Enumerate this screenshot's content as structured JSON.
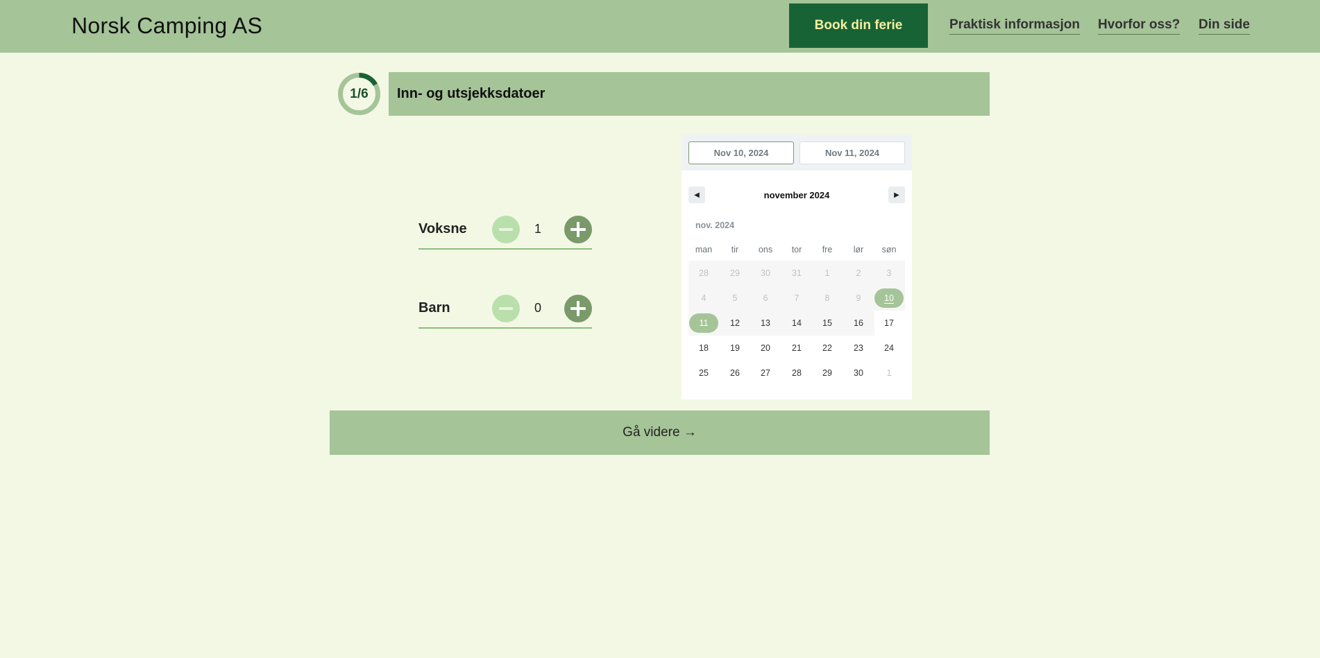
{
  "header": {
    "brand": "Norsk Camping AS",
    "book_button": "Book din ferie",
    "nav": [
      "Praktisk informasjon",
      "Hvorfor oss?",
      "Din side"
    ]
  },
  "step": {
    "indicator": "1/6",
    "progress": 0.1667,
    "title": "Inn- og utsjekksdatoer"
  },
  "guests": [
    {
      "label": "Voksne",
      "value": "1"
    },
    {
      "label": "Barn",
      "value": "0"
    }
  ],
  "datepicker": {
    "checkin": "Nov 10, 2024",
    "checkout": "Nov 11, 2024",
    "month_label": "november 2024",
    "sub_label": "nov. 2024",
    "weekdays": [
      "man",
      "tir",
      "ons",
      "tor",
      "fre",
      "lør",
      "søn"
    ],
    "weeks": [
      [
        "28",
        "29",
        "30",
        "31",
        "1",
        "2",
        "3"
      ],
      [
        "4",
        "5",
        "6",
        "7",
        "8",
        "9",
        "10"
      ],
      [
        "11",
        "12",
        "13",
        "14",
        "15",
        "16",
        "17"
      ],
      [
        "18",
        "19",
        "20",
        "21",
        "22",
        "23",
        "24"
      ],
      [
        "25",
        "26",
        "27",
        "28",
        "29",
        "30",
        "1"
      ]
    ]
  },
  "continue_button": "Gå videre →",
  "colors": {
    "page_bg": "#f3f8e4",
    "header_bg": "#a5c498",
    "book_bg": "#186335",
    "book_text": "#f5efa3",
    "plus_bg": "#7a9a6a",
    "minus_bg": "#b9e0ac"
  }
}
